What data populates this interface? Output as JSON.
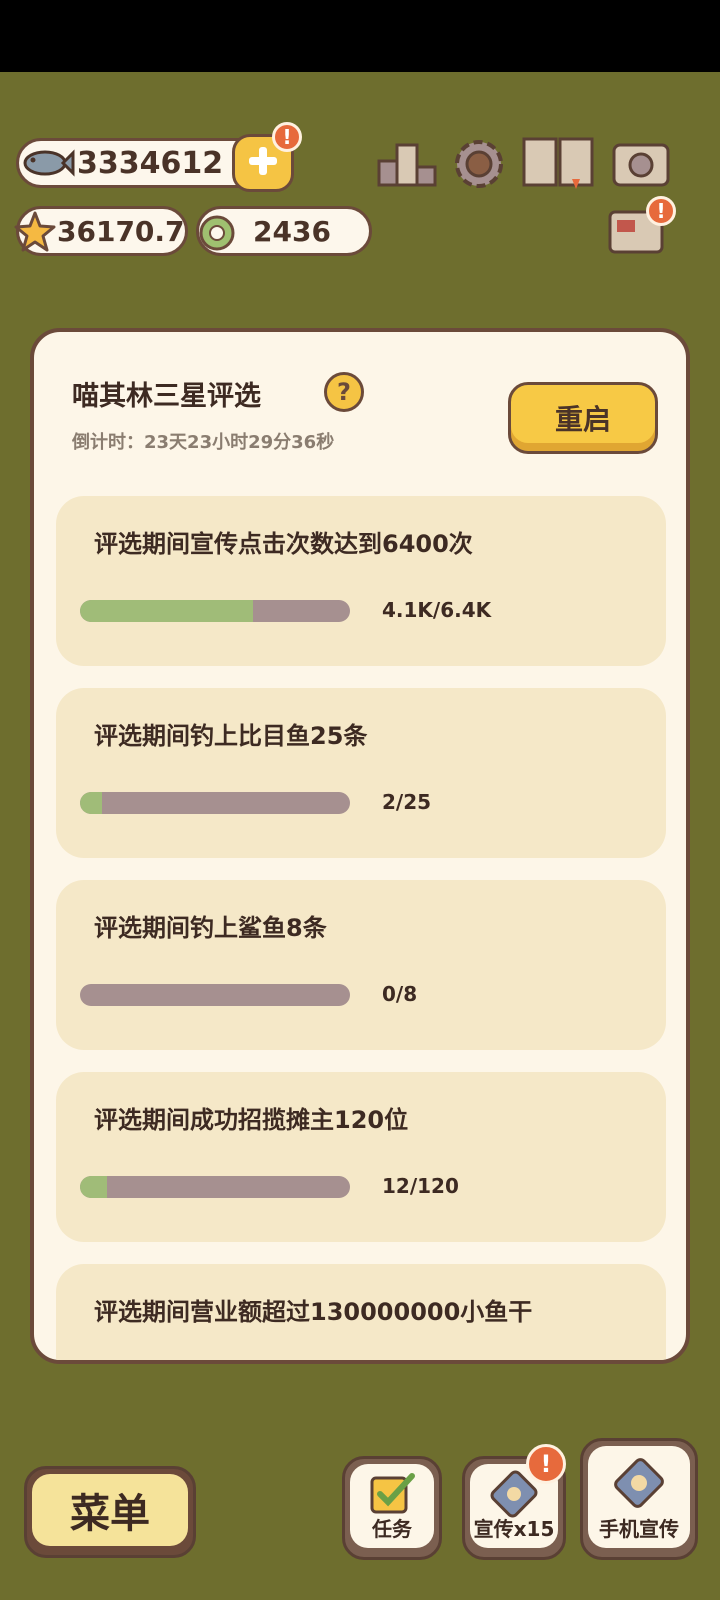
{
  "currency": {
    "fish": "3334612",
    "stars": "36170.7",
    "rings": "2436"
  },
  "badges": {
    "alert": "!"
  },
  "panel": {
    "title": "喵其林三星评选",
    "help_label": "?",
    "countdown": "倒计时：23天23小时29分36秒",
    "restart_label": "重启"
  },
  "tasks": [
    {
      "title": "评选期间宣传点击次数达到6400次",
      "progress_text": "4.1K/6.4K",
      "progress": 0.64
    },
    {
      "title": "评选期间钓上比目鱼25条",
      "progress_text": "2/25",
      "progress": 0.08
    },
    {
      "title": "评选期间钓上鲨鱼8条",
      "progress_text": "0/8",
      "progress": 0.0
    },
    {
      "title": "评选期间成功招揽摊主120位",
      "progress_text": "12/120",
      "progress": 0.1
    },
    {
      "title": "评选期间营业额超过130000000小鱼干",
      "progress_text": "",
      "progress": 0.0
    }
  ],
  "bottom_bar": {
    "menu_label": "菜单",
    "task_label": "任务",
    "promote_label": "宣传x15",
    "phone_promote_label": "手机宣传"
  },
  "colors": {
    "background": "#6e6e2e",
    "panel": "#fdf6e8",
    "card": "#f5e8c8",
    "progress_fill": "#a0bc78",
    "progress_track": "#a69090",
    "button_yellow": "#f7c945",
    "border": "#6b4a3a"
  },
  "icons": [
    "fish-icon",
    "plus-icon",
    "star-icon",
    "ring-icon",
    "ranking-icon",
    "settings-gear-icon",
    "book-icon",
    "camera-icon",
    "newspaper-icon",
    "help-icon",
    "checkbox-icon",
    "cat-paw-card-icon"
  ]
}
